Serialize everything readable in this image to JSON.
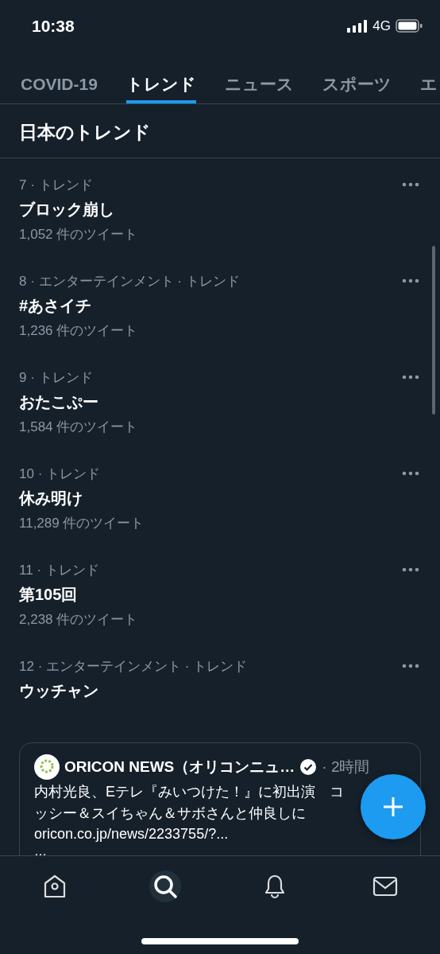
{
  "status_bar": {
    "time": "10:38",
    "network": "4G"
  },
  "tabs": [
    {
      "label": "COVID-19",
      "selected": false
    },
    {
      "label": "トレンド",
      "selected": true
    },
    {
      "label": "ニュース",
      "selected": false
    },
    {
      "label": "スポーツ",
      "selected": false
    },
    {
      "label": "エ",
      "selected": false
    }
  ],
  "section_title": "日本のトレンド",
  "trends": [
    {
      "meta": "7 · トレンド",
      "title": "ブロック崩し",
      "count": "1,052 件のツイート"
    },
    {
      "meta": "8 · エンターテインメント · トレンド",
      "title": "#あさイチ",
      "count": "1,236 件のツイート"
    },
    {
      "meta": "9 · トレンド",
      "title": "おたこぷー",
      "count": "1,584 件のツイート"
    },
    {
      "meta": "10 · トレンド",
      "title": "休み明け",
      "count": "11,289 件のツイート"
    },
    {
      "meta": "11 · トレンド",
      "title": "第105回",
      "count": "2,238 件のツイート"
    },
    {
      "meta": "12 · エンターテインメント · トレンド",
      "title": "ウッチャン"
    }
  ],
  "tweet_card": {
    "author": "ORICON NEWS（オリコンニュ…",
    "verified": true,
    "time": "· 2時間",
    "text": "内村光良、Eテレ『みいつけた！』に初出演　コッシー＆スイちゃん＆サボさんと仲良しに",
    "link": "oricon.co.jp/news/2233755/?...",
    "more": "…"
  },
  "bottom_nav": [
    {
      "kind": "home",
      "selected": false
    },
    {
      "kind": "search",
      "selected": true
    },
    {
      "kind": "notifications",
      "selected": false
    },
    {
      "kind": "messages",
      "selected": false
    }
  ]
}
